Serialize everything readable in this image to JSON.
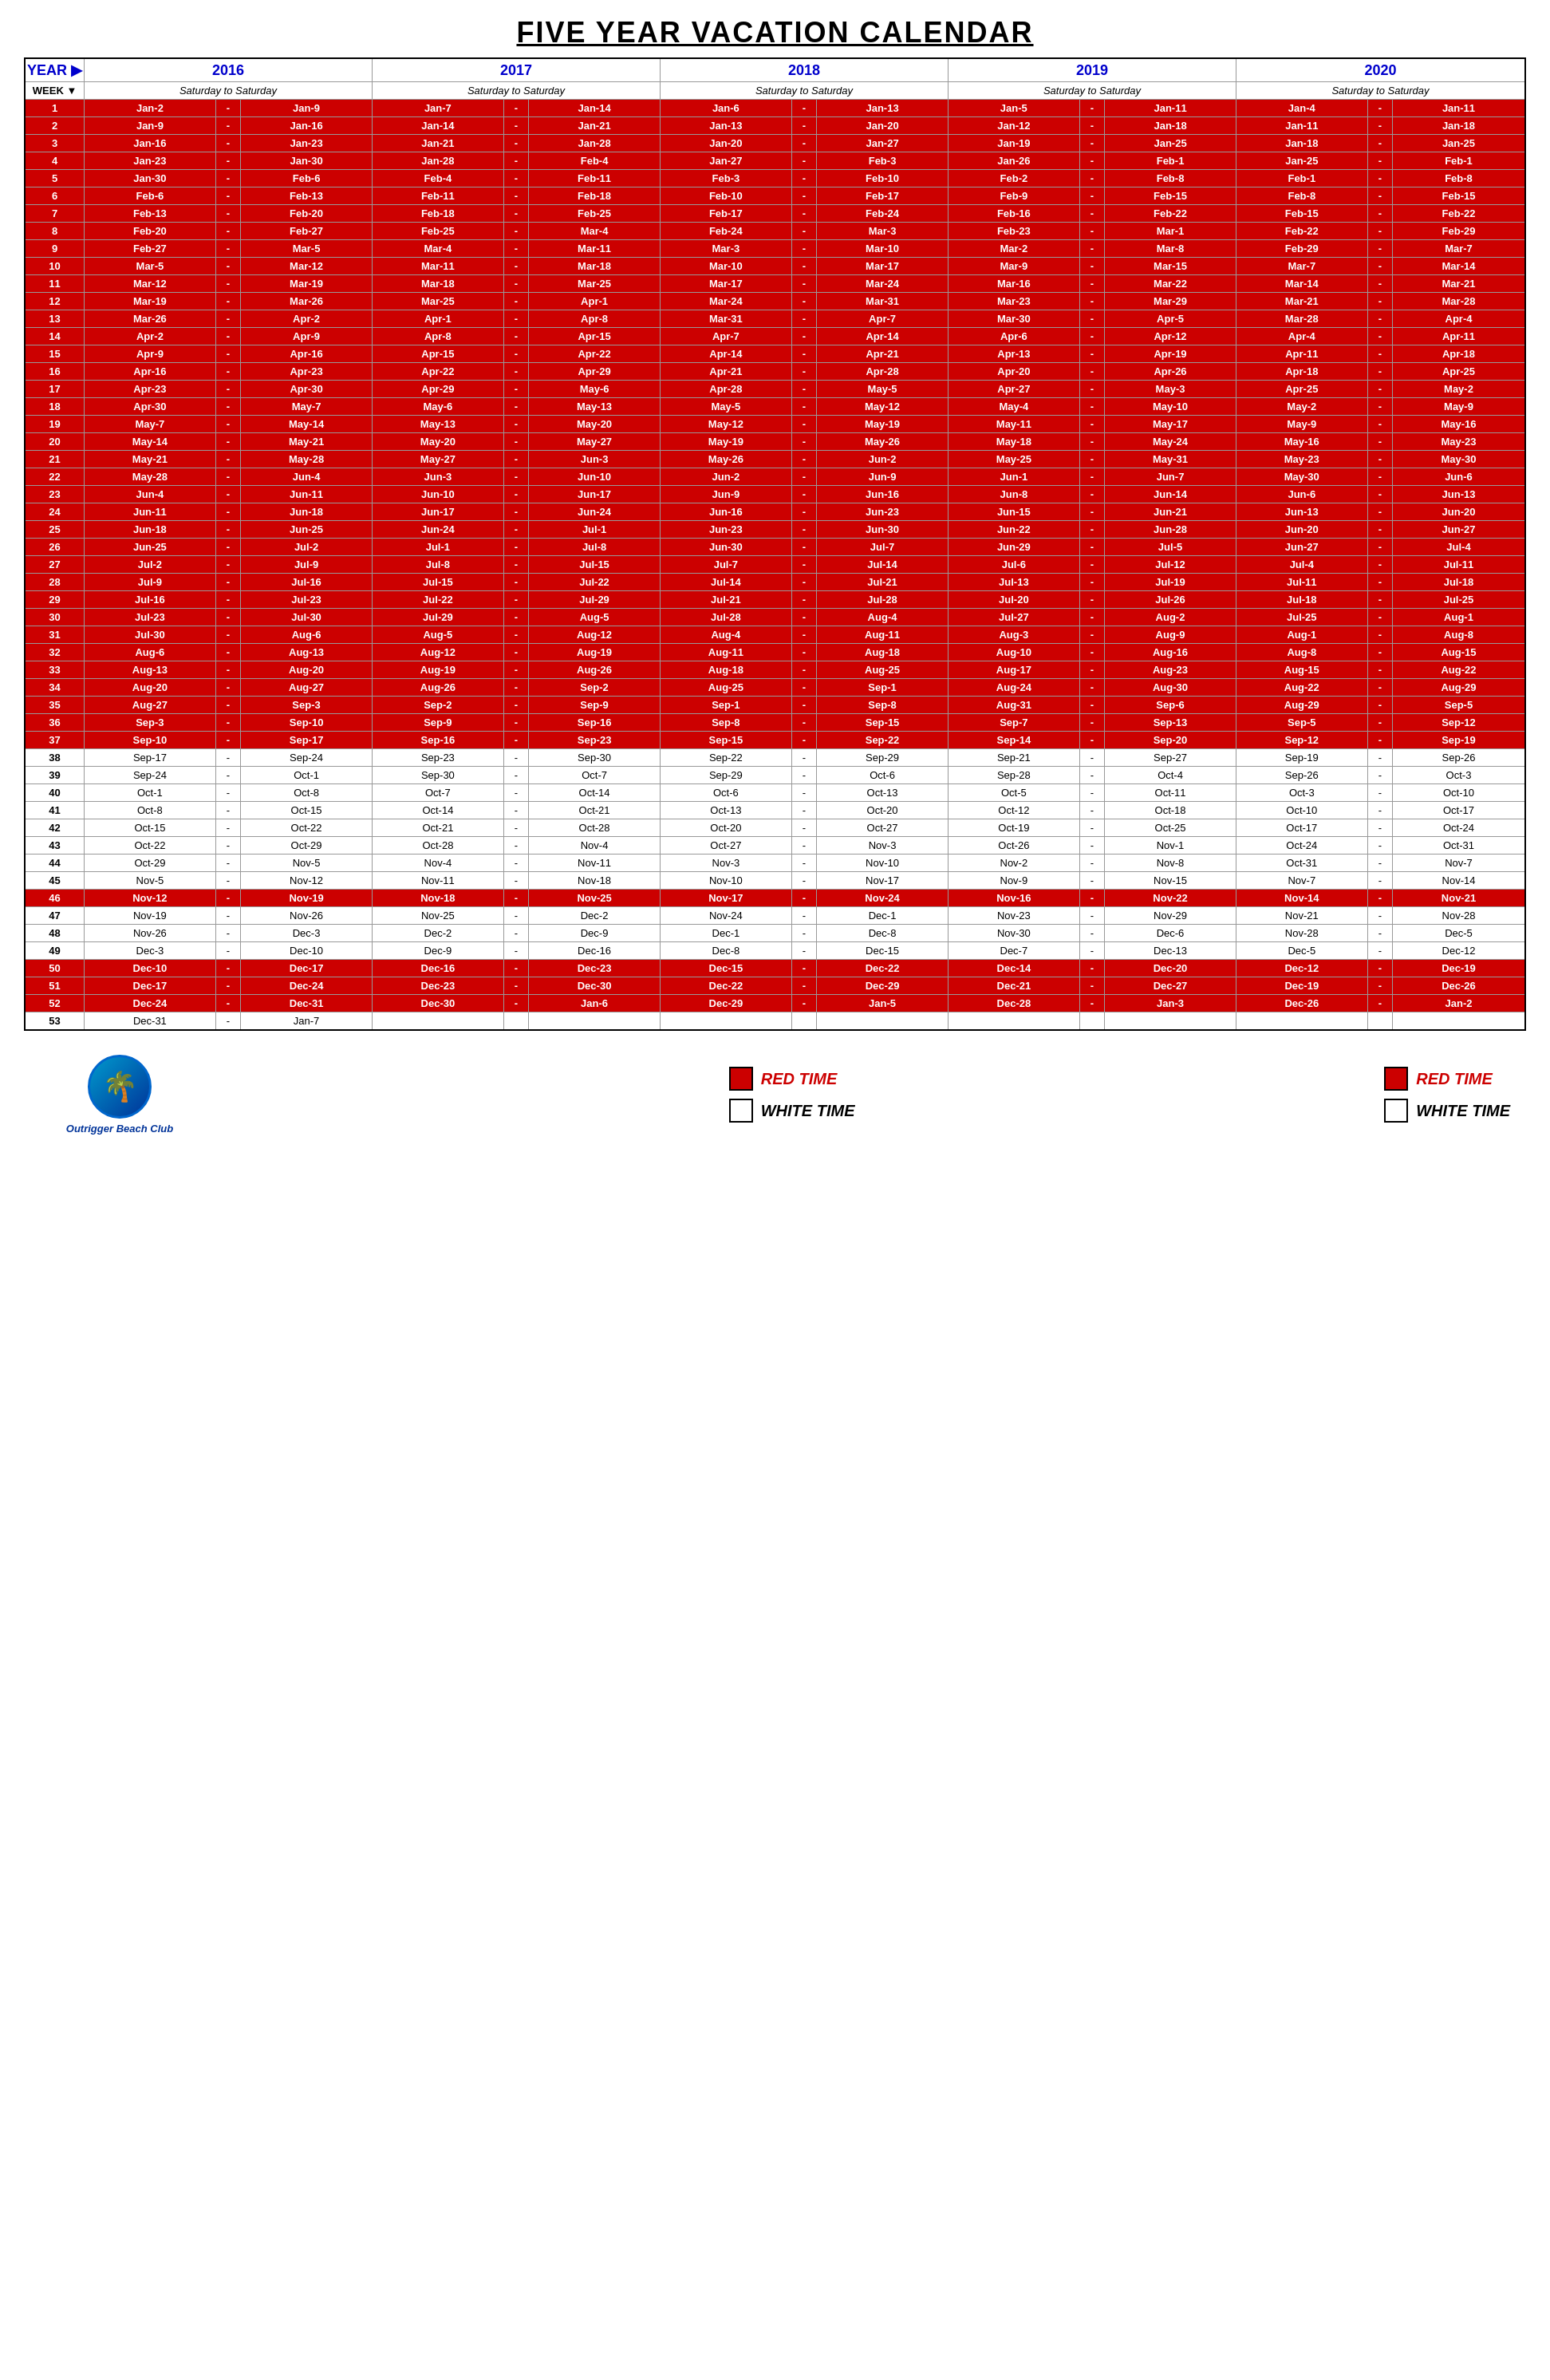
{
  "title": "FIVE YEAR VACATION CALENDAR",
  "years": [
    "2016",
    "2017",
    "2018",
    "2019",
    "2020"
  ],
  "subheader": "Saturday to Saturday",
  "headers": {
    "year_label": "YEAR ▶",
    "week_label": "WEEK ▼"
  },
  "footer": {
    "logo_name": "Outrigger Beach Club",
    "legend": [
      {
        "type": "red",
        "label": "RED TIME"
      },
      {
        "type": "white",
        "label": "WHITE TIME"
      }
    ]
  },
  "weeks": [
    {
      "week": 1,
      "red": true,
      "dates": [
        "Jan-2",
        "Jan-9",
        "Jan-7",
        "Jan-14",
        "Jan-6",
        "Jan-13",
        "Jan-5",
        "Jan-11",
        "Jan-4",
        "Jan-11"
      ]
    },
    {
      "week": 2,
      "red": true,
      "dates": [
        "Jan-9",
        "Jan-16",
        "Jan-14",
        "Jan-21",
        "Jan-13",
        "Jan-20",
        "Jan-12",
        "Jan-18",
        "Jan-11",
        "Jan-18"
      ]
    },
    {
      "week": 3,
      "red": true,
      "dates": [
        "Jan-16",
        "Jan-23",
        "Jan-21",
        "Jan-28",
        "Jan-20",
        "Jan-27",
        "Jan-19",
        "Jan-25",
        "Jan-18",
        "Jan-25"
      ]
    },
    {
      "week": 4,
      "red": true,
      "dates": [
        "Jan-23",
        "Jan-30",
        "Jan-28",
        "Feb-4",
        "Jan-27",
        "Feb-3",
        "Jan-26",
        "Feb-1",
        "Jan-25",
        "Feb-1"
      ]
    },
    {
      "week": 5,
      "red": true,
      "dates": [
        "Jan-30",
        "Feb-6",
        "Feb-4",
        "Feb-11",
        "Feb-3",
        "Feb-10",
        "Feb-2",
        "Feb-8",
        "Feb-1",
        "Feb-8"
      ]
    },
    {
      "week": 6,
      "red": true,
      "dates": [
        "Feb-6",
        "Feb-13",
        "Feb-11",
        "Feb-18",
        "Feb-10",
        "Feb-17",
        "Feb-9",
        "Feb-15",
        "Feb-8",
        "Feb-15"
      ]
    },
    {
      "week": 7,
      "red": true,
      "dates": [
        "Feb-13",
        "Feb-20",
        "Feb-18",
        "Feb-25",
        "Feb-17",
        "Feb-24",
        "Feb-16",
        "Feb-22",
        "Feb-15",
        "Feb-22"
      ]
    },
    {
      "week": 8,
      "red": true,
      "dates": [
        "Feb-20",
        "Feb-27",
        "Feb-25",
        "Mar-4",
        "Feb-24",
        "Mar-3",
        "Feb-23",
        "Mar-1",
        "Feb-22",
        "Feb-29"
      ]
    },
    {
      "week": 9,
      "red": true,
      "dates": [
        "Feb-27",
        "Mar-5",
        "Mar-4",
        "Mar-11",
        "Mar-3",
        "Mar-10",
        "Mar-2",
        "Mar-8",
        "Feb-29",
        "Mar-7"
      ]
    },
    {
      "week": 10,
      "red": true,
      "dates": [
        "Mar-5",
        "Mar-12",
        "Mar-11",
        "Mar-18",
        "Mar-10",
        "Mar-17",
        "Mar-9",
        "Mar-15",
        "Mar-7",
        "Mar-14"
      ]
    },
    {
      "week": 11,
      "red": true,
      "dates": [
        "Mar-12",
        "Mar-19",
        "Mar-18",
        "Mar-25",
        "Mar-17",
        "Mar-24",
        "Mar-16",
        "Mar-22",
        "Mar-14",
        "Mar-21"
      ]
    },
    {
      "week": 12,
      "red": true,
      "dates": [
        "Mar-19",
        "Mar-26",
        "Mar-25",
        "Apr-1",
        "Mar-24",
        "Mar-31",
        "Mar-23",
        "Mar-29",
        "Mar-21",
        "Mar-28"
      ]
    },
    {
      "week": 13,
      "red": true,
      "dates": [
        "Mar-26",
        "Apr-2",
        "Apr-1",
        "Apr-8",
        "Mar-31",
        "Apr-7",
        "Mar-30",
        "Apr-5",
        "Mar-28",
        "Apr-4"
      ]
    },
    {
      "week": 14,
      "red": true,
      "dates": [
        "Apr-2",
        "Apr-9",
        "Apr-8",
        "Apr-15",
        "Apr-7",
        "Apr-14",
        "Apr-6",
        "Apr-12",
        "Apr-4",
        "Apr-11"
      ]
    },
    {
      "week": 15,
      "red": true,
      "dates": [
        "Apr-9",
        "Apr-16",
        "Apr-15",
        "Apr-22",
        "Apr-14",
        "Apr-21",
        "Apr-13",
        "Apr-19",
        "Apr-11",
        "Apr-18"
      ]
    },
    {
      "week": 16,
      "red": true,
      "dates": [
        "Apr-16",
        "Apr-23",
        "Apr-22",
        "Apr-29",
        "Apr-21",
        "Apr-28",
        "Apr-20",
        "Apr-26",
        "Apr-18",
        "Apr-25"
      ]
    },
    {
      "week": 17,
      "red": true,
      "dates": [
        "Apr-23",
        "Apr-30",
        "Apr-29",
        "May-6",
        "Apr-28",
        "May-5",
        "Apr-27",
        "May-3",
        "Apr-25",
        "May-2"
      ]
    },
    {
      "week": 18,
      "red": true,
      "dates": [
        "Apr-30",
        "May-7",
        "May-6",
        "May-13",
        "May-5",
        "May-12",
        "May-4",
        "May-10",
        "May-2",
        "May-9"
      ]
    },
    {
      "week": 19,
      "red": true,
      "dates": [
        "May-7",
        "May-14",
        "May-13",
        "May-20",
        "May-12",
        "May-19",
        "May-11",
        "May-17",
        "May-9",
        "May-16"
      ]
    },
    {
      "week": 20,
      "red": true,
      "dates": [
        "May-14",
        "May-21",
        "May-20",
        "May-27",
        "May-19",
        "May-26",
        "May-18",
        "May-24",
        "May-16",
        "May-23"
      ]
    },
    {
      "week": 21,
      "red": true,
      "dates": [
        "May-21",
        "May-28",
        "May-27",
        "Jun-3",
        "May-26",
        "Jun-2",
        "May-25",
        "May-31",
        "May-23",
        "May-30"
      ]
    },
    {
      "week": 22,
      "red": true,
      "dates": [
        "May-28",
        "Jun-4",
        "Jun-3",
        "Jun-10",
        "Jun-2",
        "Jun-9",
        "Jun-1",
        "Jun-7",
        "May-30",
        "Jun-6"
      ]
    },
    {
      "week": 23,
      "red": true,
      "dates": [
        "Jun-4",
        "Jun-11",
        "Jun-10",
        "Jun-17",
        "Jun-9",
        "Jun-16",
        "Jun-8",
        "Jun-14",
        "Jun-6",
        "Jun-13"
      ]
    },
    {
      "week": 24,
      "red": true,
      "dates": [
        "Jun-11",
        "Jun-18",
        "Jun-17",
        "Jun-24",
        "Jun-16",
        "Jun-23",
        "Jun-15",
        "Jun-21",
        "Jun-13",
        "Jun-20"
      ]
    },
    {
      "week": 25,
      "red": true,
      "dates": [
        "Jun-18",
        "Jun-25",
        "Jun-24",
        "Jul-1",
        "Jun-23",
        "Jun-30",
        "Jun-22",
        "Jun-28",
        "Jun-20",
        "Jun-27"
      ]
    },
    {
      "week": 26,
      "red": true,
      "dates": [
        "Jun-25",
        "Jul-2",
        "Jul-1",
        "Jul-8",
        "Jun-30",
        "Jul-7",
        "Jun-29",
        "Jul-5",
        "Jun-27",
        "Jul-4"
      ]
    },
    {
      "week": 27,
      "red": true,
      "dates": [
        "Jul-2",
        "Jul-9",
        "Jul-8",
        "Jul-15",
        "Jul-7",
        "Jul-14",
        "Jul-6",
        "Jul-12",
        "Jul-4",
        "Jul-11"
      ]
    },
    {
      "week": 28,
      "red": true,
      "dates": [
        "Jul-9",
        "Jul-16",
        "Jul-15",
        "Jul-22",
        "Jul-14",
        "Jul-21",
        "Jul-13",
        "Jul-19",
        "Jul-11",
        "Jul-18"
      ]
    },
    {
      "week": 29,
      "red": true,
      "dates": [
        "Jul-16",
        "Jul-23",
        "Jul-22",
        "Jul-29",
        "Jul-21",
        "Jul-28",
        "Jul-20",
        "Jul-26",
        "Jul-18",
        "Jul-25"
      ]
    },
    {
      "week": 30,
      "red": true,
      "dates": [
        "Jul-23",
        "Jul-30",
        "Jul-29",
        "Aug-5",
        "Jul-28",
        "Aug-4",
        "Jul-27",
        "Aug-2",
        "Jul-25",
        "Aug-1"
      ]
    },
    {
      "week": 31,
      "red": true,
      "dates": [
        "Jul-30",
        "Aug-6",
        "Aug-5",
        "Aug-12",
        "Aug-4",
        "Aug-11",
        "Aug-3",
        "Aug-9",
        "Aug-1",
        "Aug-8"
      ]
    },
    {
      "week": 32,
      "red": true,
      "dates": [
        "Aug-6",
        "Aug-13",
        "Aug-12",
        "Aug-19",
        "Aug-11",
        "Aug-18",
        "Aug-10",
        "Aug-16",
        "Aug-8",
        "Aug-15"
      ]
    },
    {
      "week": 33,
      "red": true,
      "dates": [
        "Aug-13",
        "Aug-20",
        "Aug-19",
        "Aug-26",
        "Aug-18",
        "Aug-25",
        "Aug-17",
        "Aug-23",
        "Aug-15",
        "Aug-22"
      ]
    },
    {
      "week": 34,
      "red": true,
      "dates": [
        "Aug-20",
        "Aug-27",
        "Aug-26",
        "Sep-2",
        "Aug-25",
        "Sep-1",
        "Aug-24",
        "Aug-30",
        "Aug-22",
        "Aug-29"
      ]
    },
    {
      "week": 35,
      "red": true,
      "dates": [
        "Aug-27",
        "Sep-3",
        "Sep-2",
        "Sep-9",
        "Sep-1",
        "Sep-8",
        "Aug-31",
        "Sep-6",
        "Aug-29",
        "Sep-5"
      ]
    },
    {
      "week": 36,
      "red": true,
      "dates": [
        "Sep-3",
        "Sep-10",
        "Sep-9",
        "Sep-16",
        "Sep-8",
        "Sep-15",
        "Sep-7",
        "Sep-13",
        "Sep-5",
        "Sep-12"
      ]
    },
    {
      "week": 37,
      "red": true,
      "dates": [
        "Sep-10",
        "Sep-17",
        "Sep-16",
        "Sep-23",
        "Sep-15",
        "Sep-22",
        "Sep-14",
        "Sep-20",
        "Sep-12",
        "Sep-19"
      ]
    },
    {
      "week": 38,
      "red": false,
      "dates": [
        "Sep-17",
        "Sep-24",
        "Sep-23",
        "Sep-30",
        "Sep-22",
        "Sep-29",
        "Sep-21",
        "Sep-27",
        "Sep-19",
        "Sep-26"
      ]
    },
    {
      "week": 39,
      "red": false,
      "dates": [
        "Sep-24",
        "Oct-1",
        "Sep-30",
        "Oct-7",
        "Sep-29",
        "Oct-6",
        "Sep-28",
        "Oct-4",
        "Sep-26",
        "Oct-3"
      ]
    },
    {
      "week": 40,
      "red": false,
      "dates": [
        "Oct-1",
        "Oct-8",
        "Oct-7",
        "Oct-14",
        "Oct-6",
        "Oct-13",
        "Oct-5",
        "Oct-11",
        "Oct-3",
        "Oct-10"
      ]
    },
    {
      "week": 41,
      "red": false,
      "dates": [
        "Oct-8",
        "Oct-15",
        "Oct-14",
        "Oct-21",
        "Oct-13",
        "Oct-20",
        "Oct-12",
        "Oct-18",
        "Oct-10",
        "Oct-17"
      ]
    },
    {
      "week": 42,
      "red": false,
      "dates": [
        "Oct-15",
        "Oct-22",
        "Oct-21",
        "Oct-28",
        "Oct-20",
        "Oct-27",
        "Oct-19",
        "Oct-25",
        "Oct-17",
        "Oct-24"
      ]
    },
    {
      "week": 43,
      "red": false,
      "dates": [
        "Oct-22",
        "Oct-29",
        "Oct-28",
        "Nov-4",
        "Oct-27",
        "Nov-3",
        "Oct-26",
        "Nov-1",
        "Oct-24",
        "Oct-31"
      ]
    },
    {
      "week": 44,
      "red": false,
      "dates": [
        "Oct-29",
        "Nov-5",
        "Nov-4",
        "Nov-11",
        "Nov-3",
        "Nov-10",
        "Nov-2",
        "Nov-8",
        "Oct-31",
        "Nov-7"
      ]
    },
    {
      "week": 45,
      "red": false,
      "dates": [
        "Nov-5",
        "Nov-12",
        "Nov-11",
        "Nov-18",
        "Nov-10",
        "Nov-17",
        "Nov-9",
        "Nov-15",
        "Nov-7",
        "Nov-14"
      ]
    },
    {
      "week": 46,
      "red": true,
      "dates": [
        "Nov-12",
        "Nov-19",
        "Nov-18",
        "Nov-25",
        "Nov-17",
        "Nov-24",
        "Nov-16",
        "Nov-22",
        "Nov-14",
        "Nov-21"
      ]
    },
    {
      "week": 47,
      "red": false,
      "dates": [
        "Nov-19",
        "Nov-26",
        "Nov-25",
        "Dec-2",
        "Nov-24",
        "Dec-1",
        "Nov-23",
        "Nov-29",
        "Nov-21",
        "Nov-28"
      ]
    },
    {
      "week": 48,
      "red": false,
      "dates": [
        "Nov-26",
        "Dec-3",
        "Dec-2",
        "Dec-9",
        "Dec-1",
        "Dec-8",
        "Nov-30",
        "Dec-6",
        "Nov-28",
        "Dec-5"
      ]
    },
    {
      "week": 49,
      "red": false,
      "dates": [
        "Dec-3",
        "Dec-10",
        "Dec-9",
        "Dec-16",
        "Dec-8",
        "Dec-15",
        "Dec-7",
        "Dec-13",
        "Dec-5",
        "Dec-12"
      ]
    },
    {
      "week": 50,
      "red": true,
      "dates": [
        "Dec-10",
        "Dec-17",
        "Dec-16",
        "Dec-23",
        "Dec-15",
        "Dec-22",
        "Dec-14",
        "Dec-20",
        "Dec-12",
        "Dec-19"
      ]
    },
    {
      "week": 51,
      "red": true,
      "dates": [
        "Dec-17",
        "Dec-24",
        "Dec-23",
        "Dec-30",
        "Dec-22",
        "Dec-29",
        "Dec-21",
        "Dec-27",
        "Dec-19",
        "Dec-26"
      ]
    },
    {
      "week": 52,
      "red": true,
      "dates": [
        "Dec-24",
        "Dec-31",
        "Dec-30",
        "Jan-6",
        "Dec-29",
        "Jan-5",
        "Dec-28",
        "Jan-3",
        "Dec-26",
        "Jan-2"
      ]
    },
    {
      "week": 53,
      "red": false,
      "dates": [
        "Dec-31",
        "Jan-7",
        "",
        "",
        "",
        "",
        "",
        "",
        "",
        ""
      ],
      "partial": true
    }
  ]
}
